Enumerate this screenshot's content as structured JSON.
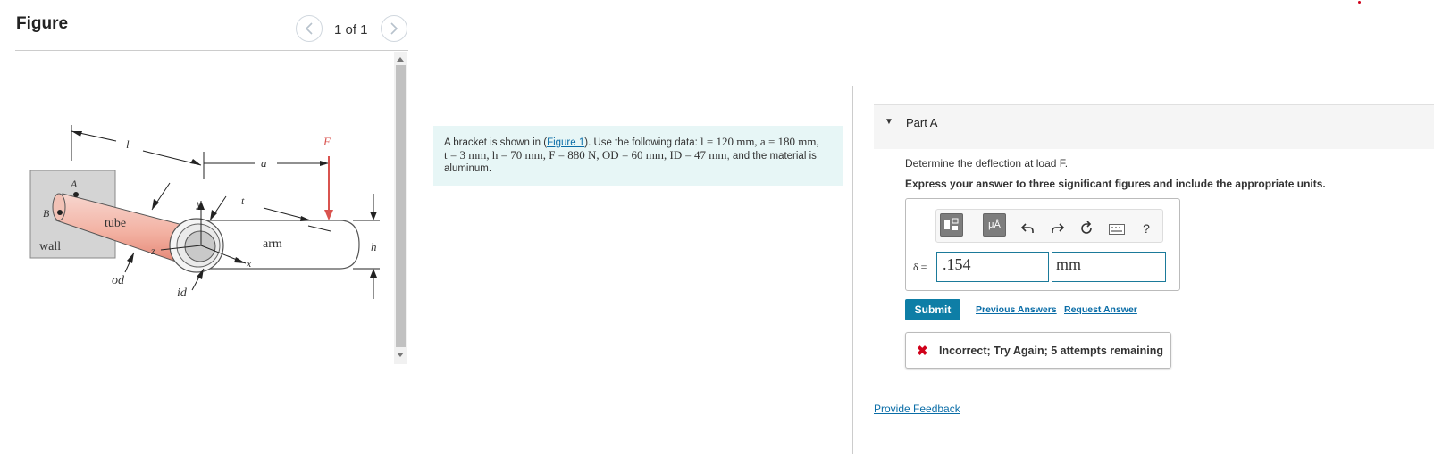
{
  "figure_panel": {
    "title": "Figure",
    "pager_text": "1 of 1",
    "labels": {
      "l": "l",
      "a": "a",
      "F": "F",
      "A": "A",
      "B": "B",
      "wall": "wall",
      "tube": "tube",
      "y": "y",
      "t1": "t",
      "t2": "t",
      "arm": "arm",
      "h": "h",
      "z": "z",
      "x": "x",
      "od": "od",
      "id": "id"
    }
  },
  "problem": {
    "intro": "A bracket is shown in (",
    "figure_link": "Figure 1",
    "after_link": "). Use the following data: ",
    "data_line1": "l = 120 mm, a = 180 mm,",
    "data_line2": "t = 3 mm, h = 70 mm, F = 880 N, OD = 60 mm, ID = 47 mm",
    "closing": ", and the material is aluminum."
  },
  "part_a": {
    "title": "Part A",
    "question": "Determine the deflection at load F.",
    "instruction": "Express your answer to three significant figures and include the appropriate units.",
    "toolbar": {
      "templates_icon": "templates-icon",
      "units_label": "μÅ",
      "help_label": "?"
    },
    "variable_label": "δ =",
    "value": ".154",
    "unit": "mm",
    "submit_label": "Submit",
    "previous_answers": "Previous Answers",
    "request_answer": "Request Answer",
    "feedback": "Incorrect; Try Again; 5 attempts remaining"
  },
  "provide_feedback": "Provide Feedback",
  "colors": {
    "accent": "#0e7ea6",
    "link": "#0a6da7",
    "error": "#d0021b",
    "problem_bg": "#e7f6f6"
  }
}
